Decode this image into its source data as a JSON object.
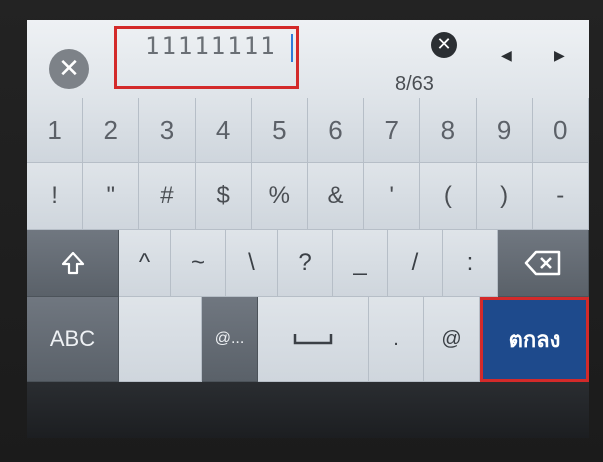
{
  "input": {
    "value": "11111111",
    "counter": "8/63"
  },
  "row1": [
    "1",
    "2",
    "3",
    "4",
    "5",
    "6",
    "7",
    "8",
    "9",
    "0"
  ],
  "row2": [
    "!",
    "\"",
    "#",
    "$",
    "%",
    "&",
    "'",
    "(",
    ")",
    "-"
  ],
  "row3": [
    "^",
    "~",
    "\\",
    "?",
    "_",
    "/",
    ":"
  ],
  "row4": {
    "abc": "ABC",
    "at_more": "@...",
    "dot": ".",
    "at": "@",
    "ok": "ตกลง"
  },
  "icons": {
    "clear_all": "close-circle-icon",
    "clear_field": "close-circle-icon",
    "cursor_left": "triangle-left-icon",
    "cursor_right": "triangle-right-icon",
    "shift": "shift-arrow-icon",
    "backspace": "backspace-icon",
    "space": "space-bar-icon"
  },
  "colors": {
    "highlight": "#d32a2a",
    "enter_bg": "#1e4a8c",
    "caret": "#2f7bd9"
  }
}
